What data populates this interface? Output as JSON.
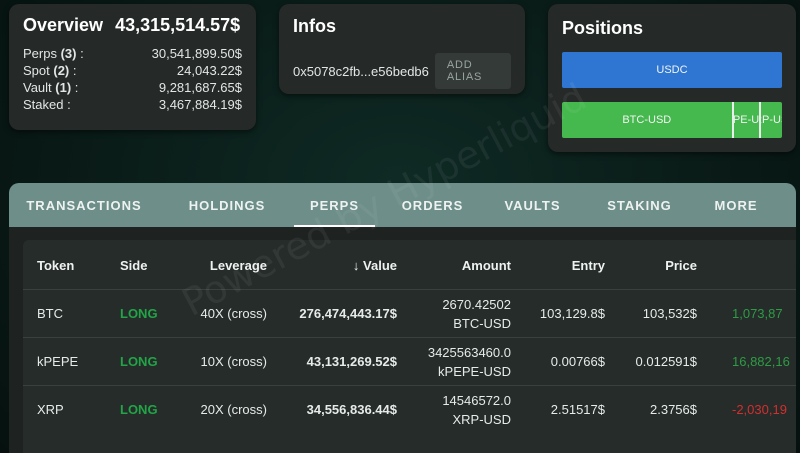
{
  "overview": {
    "title": "Overview",
    "total": "43,315,514.57$",
    "rows": [
      {
        "label": "Perps",
        "count": "(3)",
        "suffix": " :",
        "value": "30,541,899.50$"
      },
      {
        "label": "Spot",
        "count": "(2)",
        "suffix": " :",
        "value": "24,043.22$"
      },
      {
        "label": "Vault",
        "count": "(1)",
        "suffix": " :",
        "value": "9,281,687.65$"
      },
      {
        "label": "Staked",
        "count": "",
        "suffix": " :",
        "value": "3,467,884.19$"
      }
    ]
  },
  "infos": {
    "title": "Infos",
    "address": "0x5078c2fb...e56bedb6",
    "alias_button": "ADD ALIAS"
  },
  "positions": {
    "title": "Positions",
    "bars": [
      {
        "segments": [
          {
            "label": "USDC",
            "fraction": 1.0,
            "color": "#2f76d2"
          }
        ]
      },
      {
        "segments": [
          {
            "label": "BTC-USD",
            "fraction": 0.78,
            "color": "#45b84e"
          },
          {
            "label": "PEPE-USD",
            "fraction": 0.125,
            "color": "#45b84e"
          },
          {
            "label": "XRP-USD",
            "fraction": 0.095,
            "color": "#45b84e"
          }
        ]
      }
    ]
  },
  "tabs": [
    {
      "label": "TRANSACTIONS",
      "active": false
    },
    {
      "label": "HOLDINGS",
      "active": false
    },
    {
      "label": "PERPS",
      "active": true
    },
    {
      "label": "ORDERS",
      "active": false
    },
    {
      "label": "VAULTS",
      "active": false
    },
    {
      "label": "STAKING",
      "active": false
    },
    {
      "label": "MORE",
      "active": false
    }
  ],
  "table": {
    "headers": {
      "token": "Token",
      "side": "Side",
      "leverage": "Leverage",
      "value": "Value",
      "amount": "Amount",
      "entry": "Entry",
      "price": "Price"
    },
    "sort_icon": "↓",
    "rows": [
      {
        "token": "BTC",
        "side": "LONG",
        "leverage": "40X (cross)",
        "value": "276,474,443.17$",
        "amount": "2670.42502",
        "amount_unit": "BTC-USD",
        "entry": "103,129.8$",
        "price": "103,532$",
        "pnl": "1,073,87",
        "pnl_sign": "pos"
      },
      {
        "token": "kPEPE",
        "side": "LONG",
        "leverage": "10X (cross)",
        "value": "43,131,269.52$",
        "amount": "3425563460.0",
        "amount_unit": "kPEPE-USD",
        "entry": "0.00766$",
        "price": "0.012591$",
        "pnl": "16,882,16",
        "pnl_sign": "pos"
      },
      {
        "token": "XRP",
        "side": "LONG",
        "leverage": "20X (cross)",
        "value": "34,556,836.44$",
        "amount": "14546572.0",
        "amount_unit": "XRP-USD",
        "entry": "2.51517$",
        "price": "2.3756$",
        "pnl": "-2,030,19",
        "pnl_sign": "neg"
      }
    ]
  },
  "watermark": "Powered by Hyperliquid",
  "colors": {
    "long": "#22a447",
    "pnl_positive": "#2e9b45",
    "pnl_negative": "#d22f2f",
    "tabbar": "#6d8e89"
  }
}
